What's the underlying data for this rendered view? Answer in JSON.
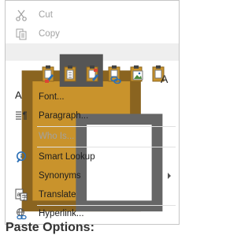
{
  "menu": {
    "cut": {
      "label": "Cut",
      "icon": "scissors-icon"
    },
    "copy": {
      "label": "Copy",
      "icon": "copy-icon"
    },
    "paste_options": {
      "label": "Paste Options:",
      "icon": "clipboard-icon"
    },
    "paste_buttons": [
      {
        "name": "keep-source-formatting-icon"
      },
      {
        "name": "merge-formatting-icon"
      },
      {
        "name": "use-destination-styles-icon"
      },
      {
        "name": "link-keep-source-icon"
      },
      {
        "name": "paste-picture-icon"
      },
      {
        "name": "keep-text-only-icon"
      }
    ],
    "font": {
      "label": "Font...",
      "icon": "font-a-icon",
      "glyph": "A"
    },
    "paragraph": {
      "label": "Paragraph...",
      "icon": "paragraph-icon"
    },
    "who_is": {
      "label": "Who Is...",
      "icon": ""
    },
    "smart_lookup": {
      "label": "Smart Lookup",
      "icon": "search-icon"
    },
    "synonyms": {
      "label": "Synonyms",
      "icon": ""
    },
    "translate": {
      "label": "Translate",
      "icon": "translate-icon"
    },
    "hyperlink": {
      "label": "Hyperlink...",
      "icon": "hyperlink-icon"
    }
  },
  "colors": {
    "accent_blue": "#2b6fb6",
    "clipboard_orange": "#c9932c",
    "disabled": "#a2a2a2"
  }
}
